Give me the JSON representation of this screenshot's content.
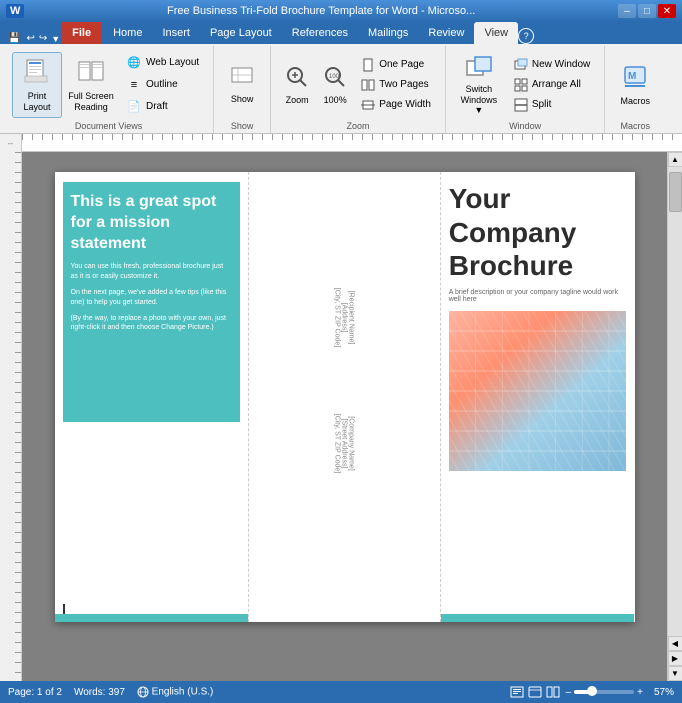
{
  "titleBar": {
    "title": "Free Business Tri-Fold Brochure Template for Word - Microsо...",
    "minimizeLabel": "–",
    "maximizeLabel": "□",
    "closeLabel": "✕",
    "appIcon": "W",
    "quickAccess": [
      "↩",
      "↪",
      "💾",
      "▼"
    ]
  },
  "ribbon": {
    "tabs": [
      "File",
      "Home",
      "Insert",
      "Page Layout",
      "References",
      "Mailings",
      "Review",
      "View"
    ],
    "activeTab": "View",
    "groups": {
      "documentViews": {
        "label": "Document Views",
        "buttons": [
          {
            "id": "print-layout",
            "label": "Print Layout",
            "active": true
          },
          {
            "id": "full-screen-reading",
            "label": "Full Screen Reading",
            "active": false
          },
          {
            "id": "web-layout",
            "label": "Web Layout"
          },
          {
            "id": "outline",
            "label": "Outline"
          },
          {
            "id": "draft",
            "label": "Draft"
          }
        ]
      },
      "show": {
        "label": "Show",
        "buttons": [
          {
            "id": "show",
            "label": "Show"
          }
        ]
      },
      "zoom": {
        "label": "Zoom",
        "buttons": [
          {
            "id": "zoom",
            "label": "Zoom"
          },
          {
            "id": "zoom-100",
            "label": "100%"
          },
          {
            "id": "one-page",
            "label": "One Page"
          },
          {
            "id": "two-pages",
            "label": "Two Pages"
          },
          {
            "id": "page-width",
            "label": "Page Width"
          }
        ]
      },
      "window": {
        "label": "Window",
        "buttons": [
          {
            "id": "new-window",
            "label": "New Window"
          },
          {
            "id": "arrange-all",
            "label": "Arrange All"
          },
          {
            "id": "split",
            "label": "Split"
          },
          {
            "id": "switch-windows",
            "label": "Switch Windows"
          }
        ]
      },
      "macros": {
        "label": "Macros",
        "buttons": [
          {
            "id": "macros",
            "label": "Macros"
          }
        ]
      }
    }
  },
  "document": {
    "leftColumn": {
      "heading": "This is a great spot for a mission statement",
      "paragraphs": [
        "You can use this fresh, professional brochure just as it is or easily customize it.",
        "On the next page, we've added a few tips (like this one) to help you get started.",
        "(By the way, to replace a photo with your own, just right-click it and then choose Change Picture.)"
      ]
    },
    "middleColumn": {
      "rotatedText1": "[Recipient Name]\n[Address]\n[City, ST ZIP Code]",
      "rotatedText2": "[Company Name]\n[Street Address]\n[City, ST ZIP Code]"
    },
    "rightColumn": {
      "heading": "Your Company Brochure",
      "tagline": "A brief description or your company tagline would work well here"
    }
  },
  "statusBar": {
    "page": "Page: 1 of 2",
    "words": "Words: 397",
    "language": "English (U.S.)",
    "zoom": "57%"
  }
}
